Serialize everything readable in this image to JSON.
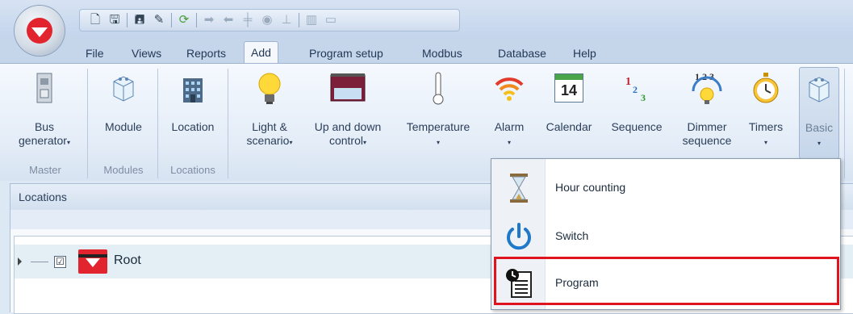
{
  "qat": {
    "icons": [
      "new-icon",
      "save-icon",
      "save-all-icon",
      "edit-icon",
      "refresh-icon",
      "send-icon",
      "receive-icon",
      "network-icon",
      "wireless-icon",
      "tree-icon",
      "layout-icon",
      "monitor-icon"
    ]
  },
  "tabs": [
    {
      "label": "File"
    },
    {
      "label": "Views"
    },
    {
      "label": "Reports"
    },
    {
      "label": "Add"
    },
    {
      "label": "Program setup"
    },
    {
      "label": "Modbus"
    },
    {
      "label": "Database"
    },
    {
      "label": "Help"
    }
  ],
  "ribbon": {
    "bus_generator": {
      "line1": "Bus",
      "line2": "generator",
      "arrow": "▾"
    },
    "module": {
      "line1": "Module"
    },
    "location": {
      "line1": "Location"
    },
    "light_scenario": {
      "line1": "Light &",
      "line2": "scenario",
      "arrow": "▾"
    },
    "up_down": {
      "line1": "Up and down",
      "line2": "control",
      "arrow": "▾"
    },
    "temperature": {
      "line1": "Temperature",
      "arrow": "▾"
    },
    "alarm": {
      "line1": "Alarm",
      "arrow": "▾"
    },
    "calendar": {
      "line1": "Calendar",
      "day": "14"
    },
    "sequence": {
      "line1": "Sequence"
    },
    "dimmer_sequence": {
      "line1": "Dimmer",
      "line2": "sequence"
    },
    "timers": {
      "line1": "Timers",
      "arrow": "▾"
    },
    "basic": {
      "line1": "Basic",
      "arrow": "▾"
    },
    "groups": {
      "master": "Master",
      "modules": "Modules",
      "locations": "Locations"
    }
  },
  "panel": {
    "title": "Locations"
  },
  "tree": {
    "root_label": "Root",
    "checked": "☑"
  },
  "menu": {
    "items": [
      {
        "label": "Hour counting",
        "icon": "hourglass-icon"
      },
      {
        "label": "Switch",
        "icon": "power-icon"
      },
      {
        "label": "Program",
        "icon": "program-icon"
      }
    ]
  },
  "colors": {
    "accent_red": "#e0141e",
    "brand_red": "#e1242d"
  }
}
